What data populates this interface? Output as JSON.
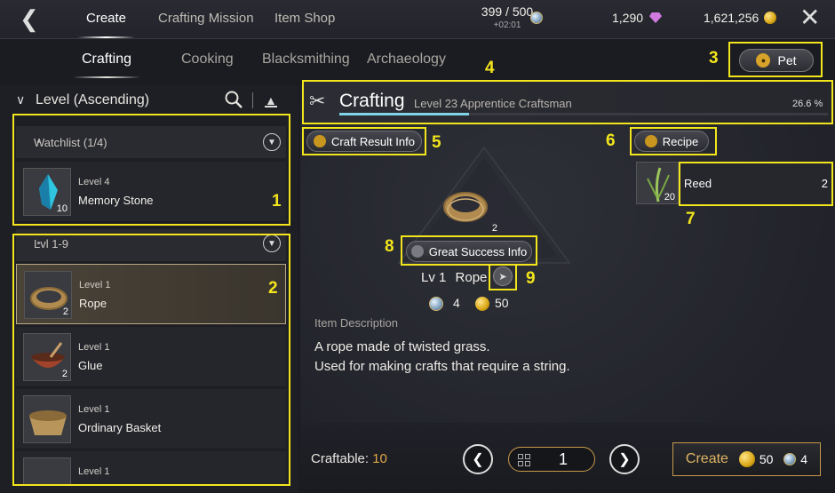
{
  "topbar": {
    "tabs": [
      "Create",
      "Crafting Mission",
      "Item Shop"
    ],
    "stamina": "399 / 500",
    "stamina_sub": "+02:01",
    "gems": "1,290",
    "gold": "1,621,256"
  },
  "subtabs": [
    "Crafting",
    "Cooking",
    "Blacksmithing",
    "Archaeology"
  ],
  "pet_label": "Pet",
  "left": {
    "sort_label": "Level (Ascending)",
    "watchlist": {
      "header": "Watchlist (1/4)",
      "items": [
        {
          "level": "Level 4",
          "name": "Memory Stone",
          "qty": "10"
        }
      ]
    },
    "group": {
      "header": "Lvl 1-9",
      "items": [
        {
          "level": "Level 1",
          "name": "Rope",
          "qty": "2"
        },
        {
          "level": "Level 1",
          "name": "Glue",
          "qty": "2"
        },
        {
          "level": "Level 1",
          "name": "Ordinary Basket",
          "qty": ""
        },
        {
          "level": "Level 1",
          "name": "",
          "qty": ""
        }
      ]
    }
  },
  "craft": {
    "title": "Crafting",
    "level_text": "Level 23  Apprentice Craftsman",
    "percent": "26.6 %",
    "progress": 0.266,
    "result_info": "Craft Result Info",
    "recipe": "Recipe",
    "great_success": "Great Success Info",
    "item_qty": "2",
    "item_lv": "Lv 1",
    "item_name": "Rope",
    "cost_silver": "4",
    "cost_gold": "50",
    "desc_label": "Item Description",
    "desc_lines": [
      "A rope made of twisted grass.",
      "Used for making crafts that require a string."
    ]
  },
  "material": {
    "name": "Reed",
    "count": "2",
    "qty": "20"
  },
  "bottom": {
    "craftable_label": "Craftable:",
    "craftable_num": "10",
    "qty": "1",
    "create_label": "Create",
    "create_gold": "50",
    "create_silver": "4"
  },
  "annotations": [
    "1",
    "2",
    "3",
    "4",
    "5",
    "6",
    "7",
    "8",
    "9"
  ],
  "colors": {
    "highlight": "#f3e51c",
    "accent_gold": "#c79a4a",
    "progress": "#7fd4e6"
  }
}
